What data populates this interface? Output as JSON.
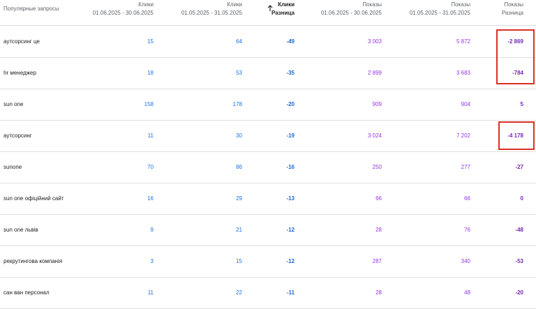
{
  "header": {
    "query_label": "Популярные запросы",
    "col1": {
      "l1": "Клики",
      "l2": "01.06.2025 - 30.06.2025"
    },
    "col2": {
      "l1": "Клики",
      "l2": "01.05.2025 - 31.05.2025"
    },
    "col3": {
      "l1": "Клики",
      "l2": "Разница"
    },
    "col4": {
      "l1": "Показы",
      "l2": "01.06.2025 - 30.06.2025"
    },
    "col5": {
      "l1": "Показы",
      "l2": "01.05.2025 - 31.05.2025"
    },
    "col6": {
      "l1": "Показы",
      "l2": "Разница"
    },
    "sort_icon": "arrow-up-icon"
  },
  "colors": {
    "clicks": "#1a73e8",
    "impressions": "#9334e6",
    "highlight": "#d93025"
  },
  "rows": [
    {
      "query": "аутсорсинг це",
      "c1": "15",
      "c2": "64",
      "c3": "-49",
      "c4": "3 003",
      "c5": "5 872",
      "c6": "-2 869"
    },
    {
      "query": "hr менеджер",
      "c1": "18",
      "c2": "53",
      "c3": "-35",
      "c4": "2 899",
      "c5": "3 683",
      "c6": "-784"
    },
    {
      "query": "sun one",
      "c1": "158",
      "c2": "178",
      "c3": "-20",
      "c4": "909",
      "c5": "904",
      "c6": "5"
    },
    {
      "query": "аутсорсинг",
      "c1": "11",
      "c2": "30",
      "c3": "-19",
      "c4": "3 024",
      "c5": "7 202",
      "c6": "-4 178"
    },
    {
      "query": "sunone",
      "c1": "70",
      "c2": "86",
      "c3": "-16",
      "c4": "250",
      "c5": "277",
      "c6": "-27"
    },
    {
      "query": "sun one офіційний сайт",
      "c1": "16",
      "c2": "29",
      "c3": "-13",
      "c4": "66",
      "c5": "66",
      "c6": "0"
    },
    {
      "query": "sun one львів",
      "c1": "9",
      "c2": "21",
      "c3": "-12",
      "c4": "28",
      "c5": "76",
      "c6": "-48"
    },
    {
      "query": "рекрутингова компанія",
      "c1": "3",
      "c2": "15",
      "c3": "-12",
      "c4": "287",
      "c5": "340",
      "c6": "-53"
    },
    {
      "query": "сан ван персонал",
      "c1": "11",
      "c2": "22",
      "c3": "-11",
      "c4": "28",
      "c5": "48",
      "c6": "-20"
    }
  ]
}
